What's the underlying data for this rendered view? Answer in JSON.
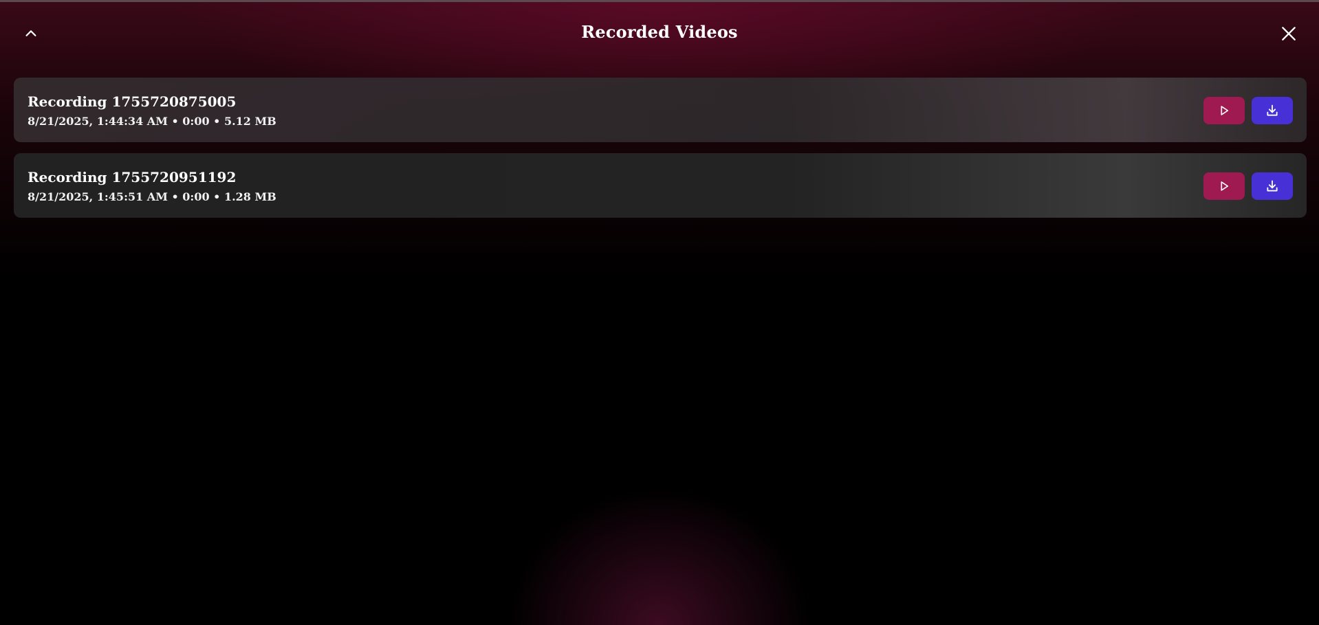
{
  "header": {
    "title": "Recorded Videos"
  },
  "recordings": [
    {
      "name": "Recording 1755720875005",
      "meta": "8/21/2025, 1:44:34 AM • 0:00 • 5.12 MB"
    },
    {
      "name": "Recording 1755720951192",
      "meta": "8/21/2025, 1:45:51 AM • 0:00 • 1.28 MB"
    }
  ],
  "colors": {
    "play_button": "#a01a52",
    "download_button": "#4630d6"
  },
  "icons": {
    "collapse": "chevron-up-icon",
    "close": "close-icon",
    "play": "play-icon",
    "download": "download-icon"
  }
}
